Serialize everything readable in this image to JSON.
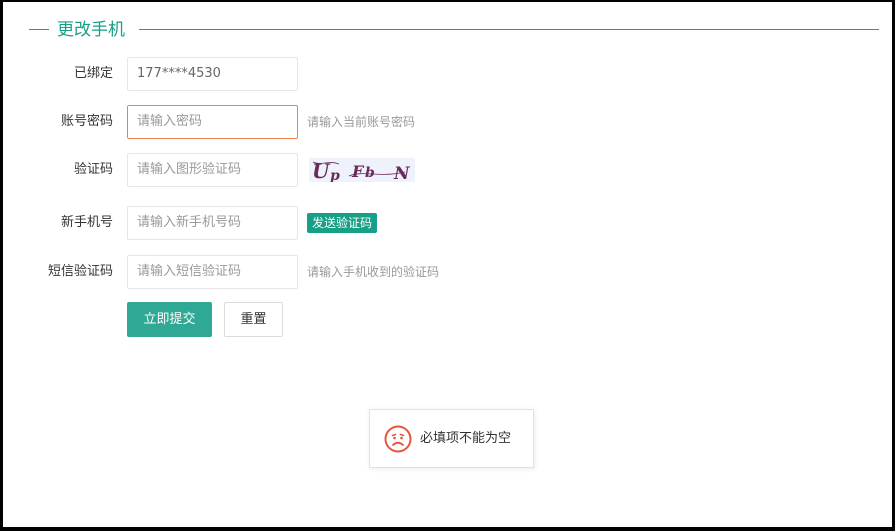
{
  "section": {
    "title": "更改手机"
  },
  "form": {
    "bound": {
      "label": "已绑定",
      "value": "177****4530"
    },
    "password": {
      "label": "账号密码",
      "placeholder": "请输入密码",
      "hint": "请输入当前账号密码"
    },
    "captcha": {
      "label": "验证码",
      "placeholder": "请输入图形验证码",
      "image_text": "Up Fb N"
    },
    "new_phone": {
      "label": "新手机号",
      "placeholder": "请输入新手机号码",
      "send_label": "发送验证码"
    },
    "sms": {
      "label": "短信验证码",
      "placeholder": "请输入短信验证码",
      "hint": "请输入手机收到的验证码"
    }
  },
  "actions": {
    "submit_label": "立即提交",
    "reset_label": "重置"
  },
  "toast": {
    "message": "必填项不能为空",
    "icon": "sad-face-icon"
  },
  "colors": {
    "accent": "#16a085",
    "focus_border": "#f0814b",
    "error_icon": "#e8533f"
  }
}
